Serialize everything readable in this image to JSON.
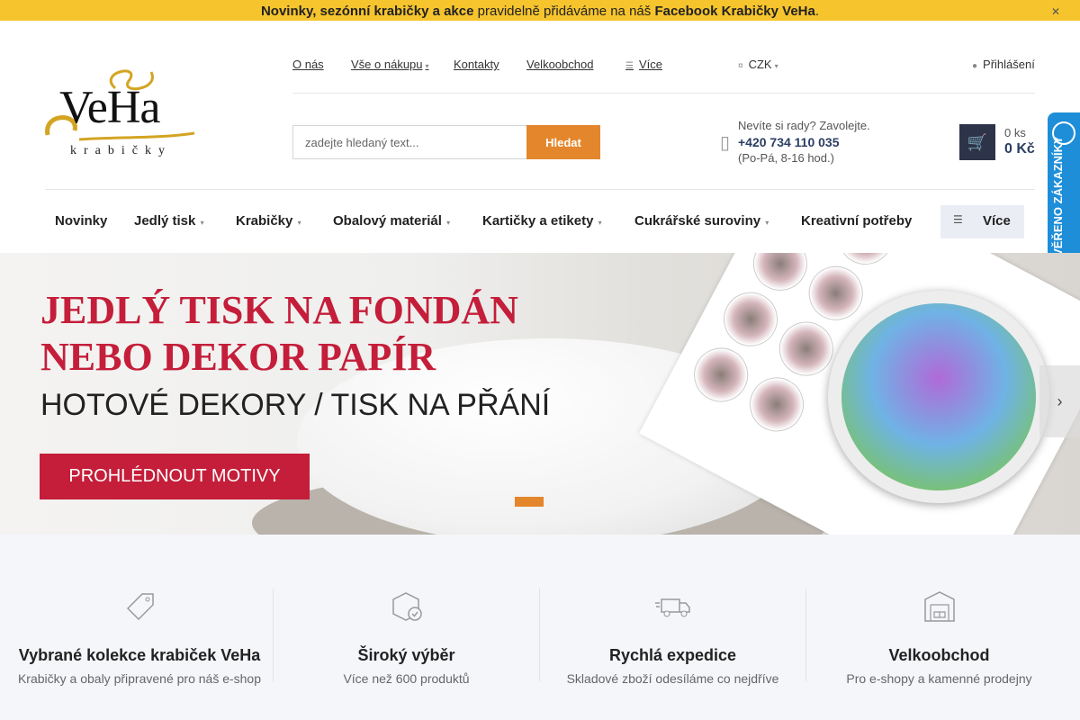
{
  "topbar": {
    "part1": "Novinky, sezónní krabičky a akce",
    "part2": " pravidelně přidáváme na náš ",
    "part3": "Facebook Krabičky VeHa",
    "part4": "."
  },
  "logo": {
    "brand": "VeHa",
    "sub": "krabičky"
  },
  "subnav": {
    "about": "O nás",
    "shopping": "Vše o nákupu",
    "contacts": "Kontakty",
    "wholesale": "Velkoobchod",
    "more": "Více",
    "currency": "CZK",
    "login": "Přihlášení"
  },
  "search": {
    "placeholder": "zadejte hledaný text...",
    "button": "Hledat"
  },
  "contact": {
    "question": "Nevíte si rady? Zavolejte.",
    "phone": "+420 734 110 035",
    "hours": "(Po-Pá, 8-16 hod.)"
  },
  "cart": {
    "count": "0 ks",
    "total": "0 Kč"
  },
  "mainnav": {
    "items": [
      "Novinky",
      "Jedlý tisk",
      "Krabičky",
      "Obalový materiál",
      "Kartičky a etikety",
      "Cukrářské suroviny",
      "Kreativní potřeby"
    ],
    "more": "Více"
  },
  "verified": {
    "label": "OVĚŘENO ZÁKAZNÍKY"
  },
  "banner": {
    "line1": "JEDLÝ TISK NA FONDÁN",
    "line2": "NEBO DEKOR PAPÍR",
    "subtitle": "HOTOVÉ DEKORY / TISK NA PŘÁNÍ",
    "cta": "PROHLÉDNOUT MOTIVY"
  },
  "features": [
    {
      "title": "Vybrané kolekce krabiček VeHa",
      "subtitle": "Krabičky a obaly připravené pro náš e-shop",
      "icon": "tag-icon"
    },
    {
      "title": "Široký výběr",
      "subtitle": "Více než 600 produktů",
      "icon": "box-check-icon"
    },
    {
      "title": "Rychlá expedice",
      "subtitle": "Skladové zboží odesíláme co nejdříve",
      "icon": "truck-icon"
    },
    {
      "title": "Velkoobchod",
      "subtitle": "Pro e-shopy a kamenné prodejny",
      "icon": "warehouse-icon"
    }
  ],
  "colors": {
    "accent": "#e4862c",
    "topbar": "#f6c42d",
    "brandRed": "#c41e3a",
    "navy": "#2d3348",
    "verified": "#1e8ed8"
  }
}
